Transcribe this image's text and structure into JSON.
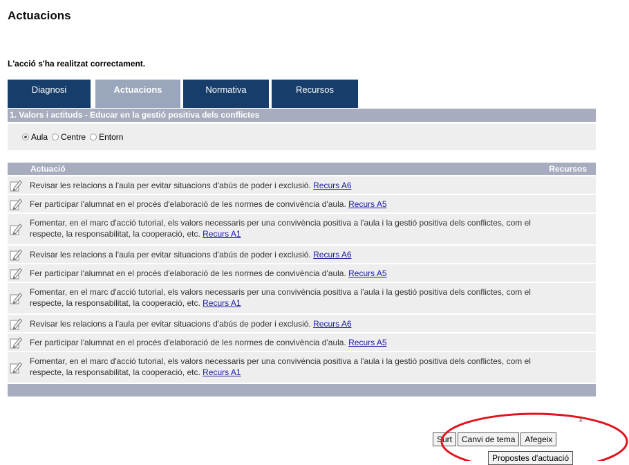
{
  "page": {
    "title": "Actuacions",
    "success_message": "L'acció s'ha realitzat correctament."
  },
  "tabs": [
    {
      "label": "Diagnosi",
      "active": false
    },
    {
      "label": "Actuacions",
      "active": true
    },
    {
      "label": "Normativa",
      "active": false
    },
    {
      "label": "Recursos",
      "active": false
    }
  ],
  "section": {
    "title": "1. Valors i actituds - Educar en la gestió positiva dels conflictes"
  },
  "scope": {
    "options": [
      {
        "label": "Aula",
        "checked": true
      },
      {
        "label": "Centre",
        "checked": false
      },
      {
        "label": "Entorn",
        "checked": false
      }
    ]
  },
  "table": {
    "columns": {
      "action": "Actuació",
      "resources": "Recursos"
    },
    "rows": [
      {
        "text": "Revisar les relacions a l'aula per evitar situacions d'abús de poder i exclusió.",
        "link": "Recurs A6"
      },
      {
        "text": "Fer participar l'alumnat en el procés d'elaboració de les normes de convivència d'aula.",
        "link": "Recurs A5"
      },
      {
        "text": "Fomentar, en el marc d'acció tutorial, els valors necessaris per una convivència positiva a l'aula i la gestió positiva dels conflictes, com el respecte, la responsabilitat, la cooperació, etc.",
        "link": "Recurs A1"
      },
      {
        "text": "Revisar les relacions a l'aula per evitar situacions d'abús de poder i exclusió.",
        "link": "Recurs A6"
      },
      {
        "text": "Fer participar l'alumnat en el procés d'elaboració de les normes de convivència d'aula.",
        "link": "Recurs A5"
      },
      {
        "text": "Fomentar, en el marc d'acció tutorial, els valors necessaris per una convivència positiva a l'aula i la gestió positiva dels conflictes, com el respecte, la responsabilitat, la cooperació, etc.",
        "link": "Recurs A1"
      },
      {
        "text": "Revisar les relacions a l'aula per evitar situacions d'abús de poder i exclusió.",
        "link": "Recurs A6"
      },
      {
        "text": "Fer participar l'alumnat en el procés d'elaboració de les normes de convivència d'aula.",
        "link": "Recurs A5"
      },
      {
        "text": "Fomentar, en el marc d'acció tutorial, els valors necessaris per una convivència positiva a l'aula i la gestió positiva dels conflictes, com el respecte, la responsabilitat, la cooperació, etc.",
        "link": "Recurs A1"
      }
    ]
  },
  "pagination": {
    "page": "1"
  },
  "actions": {
    "exit": "Surt",
    "change_topic": "Canvi de tema",
    "add": "Afegeix",
    "proposals": "Propostes d'actuació"
  },
  "icons": {
    "row_icon": "pencil-edit-icon"
  },
  "colors": {
    "tab_bg": "#173e6a",
    "tab_active_bg": "#9aa6bb",
    "header_bar": "#a7acbe",
    "row_bg": "#eeeeee",
    "link": "#1a1aa6",
    "annotation": "#e0141e"
  }
}
